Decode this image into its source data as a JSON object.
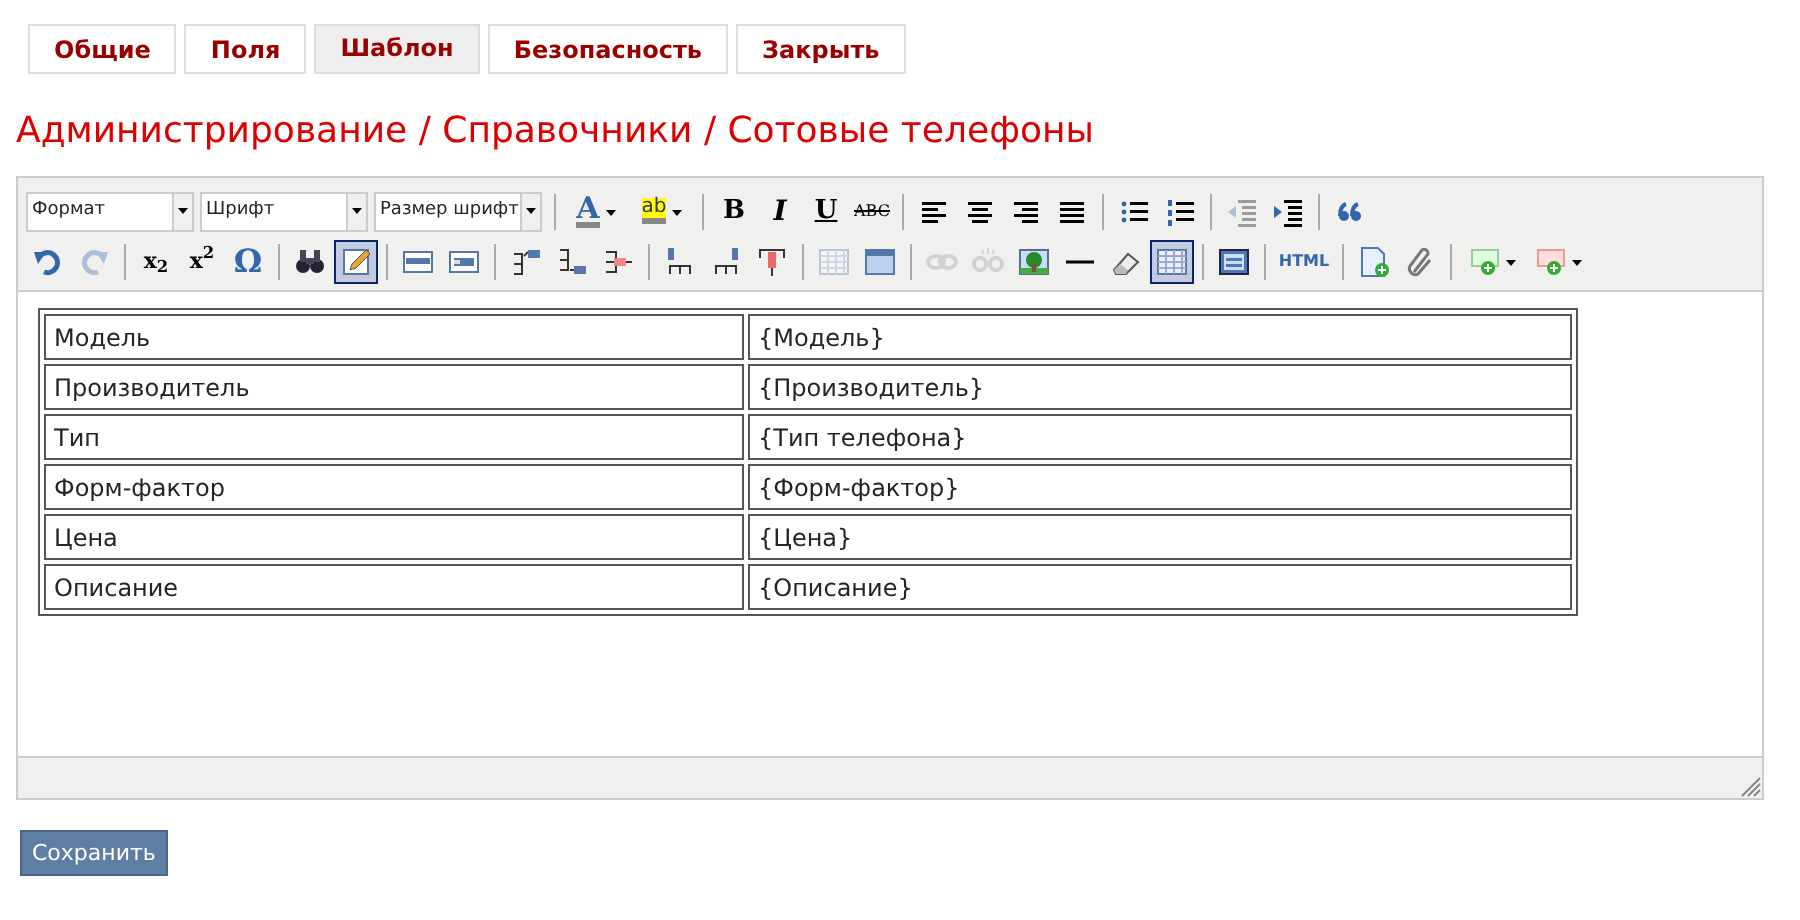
{
  "tabs": [
    {
      "label": "Общие",
      "selected": false
    },
    {
      "label": "Поля",
      "selected": false
    },
    {
      "label": "Шаблон",
      "selected": true
    },
    {
      "label": "Безопасность",
      "selected": false
    },
    {
      "label": "Закрыть",
      "selected": false
    }
  ],
  "title": "Администрирование / Справочники / Сотовые телефоны",
  "toolbar": [
    [
      {
        "kind": "combo",
        "label": "Формат"
      },
      {
        "kind": "combo",
        "label": "Шрифт"
      },
      {
        "kind": "combo",
        "label": "Размер шрифт"
      },
      {
        "kind": "sep"
      },
      {
        "kind": "textcolor",
        "label": "A"
      },
      {
        "kind": "highlight",
        "label": "ab"
      },
      {
        "kind": "sep"
      },
      {
        "kind": "bold",
        "label": "B",
        "disabled": false,
        "pressed": false
      },
      {
        "kind": "italic",
        "label": "I",
        "disabled": false,
        "pressed": false
      },
      {
        "kind": "underline",
        "label": "U",
        "disabled": false,
        "pressed": false
      },
      {
        "kind": "strike",
        "label": "ABC",
        "disabled": false,
        "pressed": false
      },
      {
        "kind": "sep"
      },
      {
        "kind": "alignleft",
        "disabled": false,
        "pressed": false
      },
      {
        "kind": "aligncenter",
        "disabled": false,
        "pressed": false
      },
      {
        "kind": "alignright",
        "disabled": false,
        "pressed": false
      },
      {
        "kind": "justify",
        "disabled": false,
        "pressed": false
      },
      {
        "kind": "sep"
      },
      {
        "kind": "bullets",
        "disabled": false,
        "pressed": false
      },
      {
        "kind": "numbers",
        "disabled": false,
        "pressed": false
      },
      {
        "kind": "sep"
      },
      {
        "kind": "outdent",
        "disabled": true,
        "pressed": false
      },
      {
        "kind": "indent",
        "disabled": false,
        "pressed": false
      },
      {
        "kind": "sep"
      },
      {
        "kind": "quote",
        "disabled": false,
        "pressed": false
      }
    ],
    [
      {
        "kind": "undo",
        "disabled": false,
        "pressed": false
      },
      {
        "kind": "redo",
        "disabled": true,
        "pressed": false
      },
      {
        "kind": "sep"
      },
      {
        "kind": "subscript",
        "label": "x$_{2}$",
        "disabled": false,
        "pressed": false
      },
      {
        "kind": "superscript",
        "label": "x$^{2}$",
        "disabled": false,
        "pressed": false
      },
      {
        "kind": "symbol",
        "label": "Ω",
        "disabled": false,
        "pressed": false
      },
      {
        "kind": "sep"
      },
      {
        "kind": "find",
        "disabled": false,
        "pressed": false
      },
      {
        "kind": "template",
        "disabled": false,
        "pressed": true
      },
      {
        "kind": "sep"
      },
      {
        "kind": "rowbefore",
        "disabled": false,
        "pressed": false
      },
      {
        "kind": "rowafter",
        "disabled": false,
        "pressed": false
      },
      {
        "kind": "sep"
      },
      {
        "kind": "colbefore",
        "disabled": false,
        "pressed": false
      },
      {
        "kind": "colafter",
        "disabled": false,
        "pressed": false
      },
      {
        "kind": "deletecol",
        "disabled": false,
        "pressed": false
      },
      {
        "kind": "sep"
      },
      {
        "kind": "rowtop",
        "disabled": false,
        "pressed": false
      },
      {
        "kind": "rowbottom",
        "disabled": false,
        "pressed": false
      },
      {
        "kind": "deleterow",
        "disabled": false,
        "pressed": false
      },
      {
        "kind": "sep"
      },
      {
        "kind": "mergecells",
        "disabled": true,
        "pressed": false
      },
      {
        "kind": "splitcells",
        "disabled": false,
        "pressed": false
      },
      {
        "kind": "sep"
      },
      {
        "kind": "link",
        "disabled": true,
        "pressed": false
      },
      {
        "kind": "unlink",
        "disabled": true,
        "pressed": false
      },
      {
        "kind": "image",
        "disabled": false,
        "pressed": false
      },
      {
        "kind": "hr",
        "disabled": false,
        "pressed": false
      },
      {
        "kind": "eraser",
        "disabled": false,
        "pressed": false
      },
      {
        "kind": "table",
        "disabled": false,
        "pressed": true
      },
      {
        "kind": "sep"
      },
      {
        "kind": "frame",
        "disabled": false,
        "pressed": false
      },
      {
        "kind": "sep"
      },
      {
        "kind": "html",
        "label": "HTML",
        "disabled": false,
        "pressed": false
      },
      {
        "kind": "sep"
      },
      {
        "kind": "newdoc",
        "disabled": false,
        "pressed": false
      },
      {
        "kind": "clip",
        "disabled": false,
        "pressed": false
      },
      {
        "kind": "sep"
      },
      {
        "kind": "addgreen",
        "disabled": false,
        "pressed": false
      },
      {
        "kind": "addred",
        "disabled": false,
        "pressed": false
      }
    ]
  ],
  "table": [
    [
      "Модель",
      "{Модель}"
    ],
    [
      "Производитель",
      "{Производитель}"
    ],
    [
      "Тип",
      "{Тип телефона}"
    ],
    [
      "Форм-фактор",
      "{Форм-фактор}"
    ],
    [
      "Цена",
      "{Цена}"
    ],
    [
      "Описание",
      "{Описание}"
    ]
  ],
  "save_button": "Сохранить"
}
